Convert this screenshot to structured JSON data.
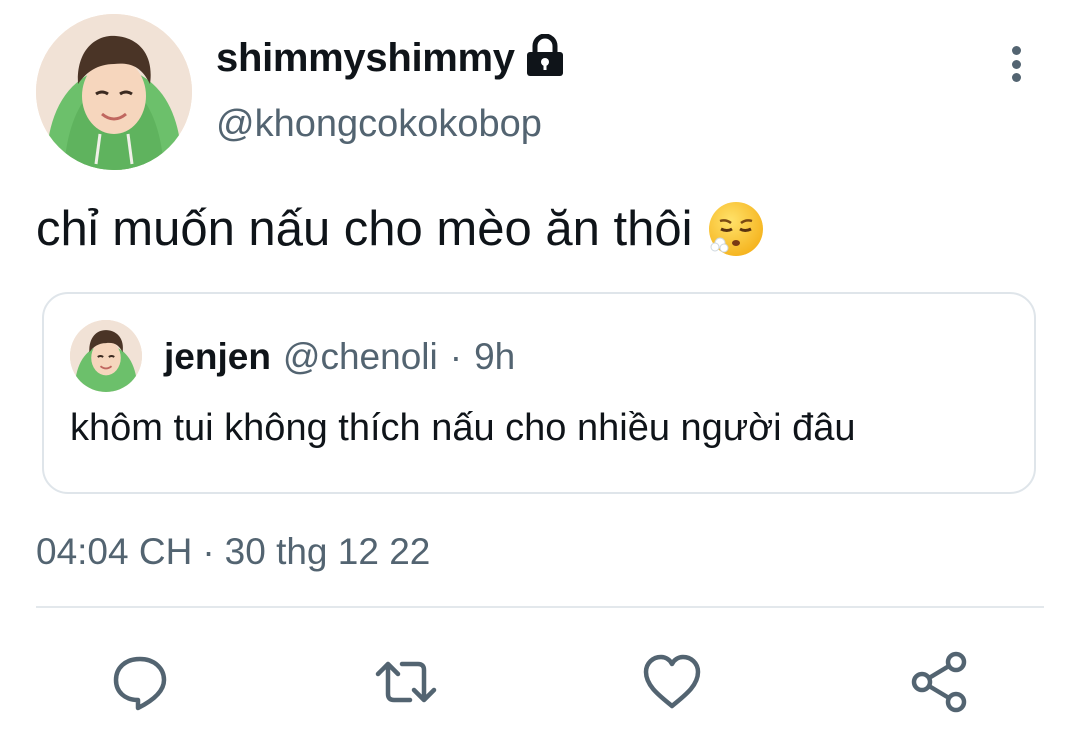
{
  "tweet": {
    "display_name": "shimmyshimmy",
    "handle": "@khongcokokobop",
    "protected_icon": "lock-icon",
    "more_icon": "more-vertical-icon",
    "text": "chỉ muốn nấu cho mèo ăn thôi",
    "emoji": "face-exhaling-emoji"
  },
  "quote": {
    "display_name": "jenjen",
    "handle": "@chenoli",
    "separator": "·",
    "time": "9h",
    "text": "khôm tui không thích nấu cho nhiều người đâu"
  },
  "meta": {
    "time": "04:04 CH",
    "separator": "·",
    "date": "30 thg 12 22"
  },
  "actions": [
    {
      "name": "reply",
      "icon": "reply-icon"
    },
    {
      "name": "retweet",
      "icon": "retweet-icon"
    },
    {
      "name": "like",
      "icon": "heart-icon"
    },
    {
      "name": "share",
      "icon": "share-icon"
    }
  ],
  "colors": {
    "primary_text": "#0f1419",
    "secondary_text": "#536471",
    "border": "#dfe5ea",
    "icon": "#536471",
    "avatar_hoodie": "#6cc06b"
  }
}
